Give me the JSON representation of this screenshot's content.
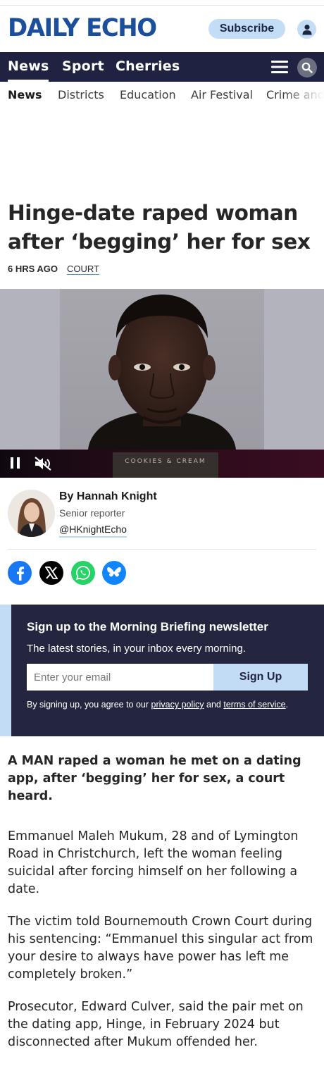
{
  "header": {
    "logo_text": "DAILY ECHO",
    "subscribe_label": "Subscribe",
    "brand_color": "#1b4f9c"
  },
  "primary_nav": {
    "items": [
      {
        "label": "News",
        "active": true
      },
      {
        "label": "Sport",
        "active": false
      },
      {
        "label": "Cherries",
        "active": false
      }
    ],
    "background": "#1f2240"
  },
  "secondary_nav": {
    "items": [
      {
        "label": "News",
        "active": true
      },
      {
        "label": "Districts",
        "active": false
      },
      {
        "label": "Education",
        "active": false
      },
      {
        "label": "Air Festival",
        "active": false
      },
      {
        "label": "Crime and",
        "active": false
      }
    ]
  },
  "article": {
    "headline": "Hinge-date raped woman after ‘begging’ her for sex",
    "published": "6 HRS AGO",
    "category": "COURT",
    "standfirst": "A MAN raped a woman he met on a dating app, after ‘begging’ her for sex, a court heard.",
    "paragraphs": [
      "Emmanuel Maleh Mukum, 28 and of Lymington Road in Christchurch, left the woman feeling suicidal after forcing himself on her following a date.",
      "The victim told Bournemouth Crown Court during his sentencing: “Emmanuel this singular act from your desire to always have power has left me completely broken.”",
      "Prosecutor, Edward Culver, said the pair met on the dating app, Hinge, in February 2024 but disconnected after Mukum offended her."
    ]
  },
  "video": {
    "sign_text": "COOKIES & CREAM"
  },
  "author": {
    "byline": "By Hannah Knight",
    "role": "Senior reporter",
    "handle": "@HKnightEcho"
  },
  "share": {
    "icons": [
      "facebook-icon",
      "x-icon",
      "whatsapp-icon",
      "bluesky-icon"
    ],
    "colors": {
      "facebook": "#1877f2",
      "x": "#000000",
      "whatsapp": "#25d366",
      "bluesky": "#1185fe"
    }
  },
  "newsletter": {
    "title": "Sign up to the Morning Briefing newsletter",
    "subtitle": "The latest stories, in your inbox every morning.",
    "email_placeholder": "Enter your email",
    "button_label": "Sign Up",
    "legal_prefix": "By signing up, you agree to our ",
    "privacy_link": "privacy policy",
    "legal_and": " and ",
    "terms_link": "terms of service",
    "legal_suffix": ".",
    "accent": "#c2dcf5"
  }
}
